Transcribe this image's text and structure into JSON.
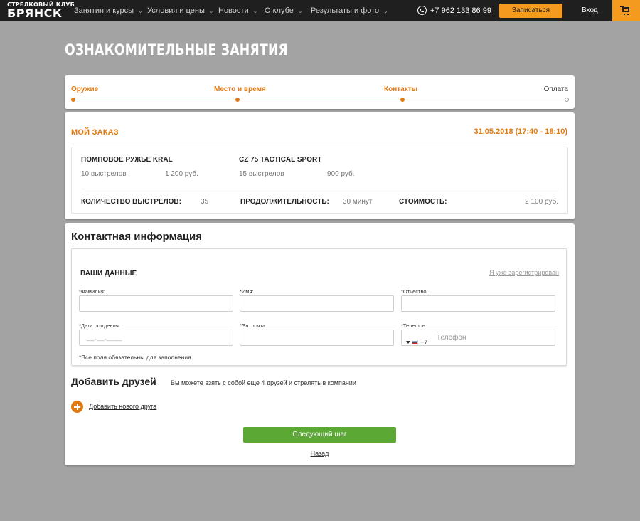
{
  "header": {
    "logo_line1": "СТРЕЛКОВЫЙ КЛУБ",
    "logo_line2": "БРЯНСК",
    "nav": [
      {
        "label": "Занятия и курсы"
      },
      {
        "label": "Условия и цены"
      },
      {
        "label": "Новости"
      },
      {
        "label": "О клубе"
      },
      {
        "label": "Результаты и фото"
      }
    ],
    "phone": "+7 962 133 86 99",
    "signup_label": "Записаться",
    "login_label": "Вход"
  },
  "page": {
    "title": "ОЗНАКОМИТЕЛЬНЫЕ ЗАНЯТИЯ"
  },
  "stepper": {
    "steps": [
      {
        "label": "Оружие",
        "state": "done"
      },
      {
        "label": "Место и время",
        "state": "done"
      },
      {
        "label": "Контакты",
        "state": "current"
      },
      {
        "label": "Оплата",
        "state": "pending"
      }
    ]
  },
  "order": {
    "title": "МОЙ ЗАКАЗ",
    "date": "31.05.2018 (17:40 - 18:10)",
    "items": [
      {
        "name": "ПОМПОВОЕ РУЖЬЕ KRAL",
        "shots": "10 выстрелов",
        "price": "1 200 руб."
      },
      {
        "name": "CZ 75 TACTICAL SPORT",
        "shots": "15 выстрелов",
        "price": "900 руб."
      }
    ],
    "summary": {
      "shots_label": "КОЛИЧЕСТВО ВЫСТРЕЛОВ:",
      "shots_value": "35",
      "duration_label": "ПРОДОЛЖИТЕЛЬНОСТЬ:",
      "duration_value": "30 минут",
      "cost_label": "СТОИМОСТЬ:",
      "cost_value": "2 100 руб."
    }
  },
  "contacts": {
    "title": "Контактная информация",
    "data_title": "ВАШИ ДАННЫЕ",
    "registered_link": "Я уже зарегистрирован",
    "fields": {
      "last_name_label": "*Фамилия:",
      "first_name_label": "*Имя:",
      "patronymic_label": "*Отчество:",
      "birth_label": "*Дата рождения:",
      "birth_placeholder": "__.__.____",
      "email_label": "*Эл. почта:",
      "phone_label": "*Телефон:",
      "phone_code": "+7",
      "phone_placeholder": "Телефон"
    },
    "required_note": "*Все поля обязательны для заполнения",
    "friends_title": "Добавить друзей",
    "friends_note": "Вы можете взять с собой еще 4 друзей и стрелять в компании",
    "add_friend_label": "Добавить нового друга",
    "next_label": "Следующий шаг",
    "back_label": "Назад"
  },
  "colors": {
    "accent_orange": "#e07b14",
    "button_orange": "#f39a1f",
    "button_green": "#5ba835",
    "header_bg": "#1f1f1f",
    "page_bg": "#a3a3a3"
  },
  "icons": {
    "phone": "phone-icon",
    "cart": "cart-icon",
    "chevron": "chevron-down-icon",
    "plus": "plus-circle-icon",
    "flag": "russia-flag-icon"
  }
}
